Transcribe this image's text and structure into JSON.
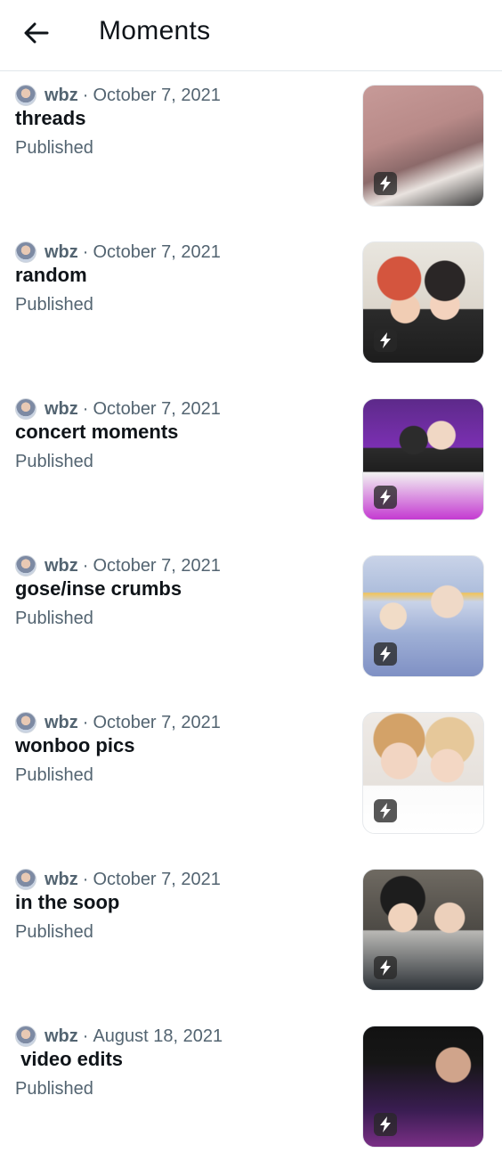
{
  "header": {
    "title": "Moments",
    "back_icon": "arrow-left-icon"
  },
  "colors": {
    "text_primary": "#0f1419",
    "text_secondary": "#536471",
    "divider": "#e1e6ea"
  },
  "moments": [
    {
      "author": "wbz",
      "separator": "·",
      "date": "October 7, 2021",
      "title": "threads",
      "status": "Published",
      "badge_icon": "lightning-bolt-icon"
    },
    {
      "author": "wbz",
      "separator": "·",
      "date": "October 7, 2021",
      "title": "random",
      "status": "Published",
      "badge_icon": "lightning-bolt-icon"
    },
    {
      "author": "wbz",
      "separator": "·",
      "date": "October 7, 2021",
      "title": "concert moments",
      "status": "Published",
      "badge_icon": "lightning-bolt-icon"
    },
    {
      "author": "wbz",
      "separator": "·",
      "date": "October 7, 2021",
      "title": "gose/inse crumbs",
      "status": "Published",
      "badge_icon": "lightning-bolt-icon"
    },
    {
      "author": "wbz",
      "separator": "·",
      "date": "October 7, 2021",
      "title": "wonboo pics",
      "status": "Published",
      "badge_icon": "lightning-bolt-icon"
    },
    {
      "author": "wbz",
      "separator": "·",
      "date": "October 7, 2021",
      "title": "in the soop",
      "status": "Published",
      "badge_icon": "lightning-bolt-icon"
    },
    {
      "author": "wbz",
      "separator": "·",
      "date": "August 18, 2021",
      "title": " video edits",
      "status": "Published",
      "badge_icon": "lightning-bolt-icon"
    }
  ]
}
